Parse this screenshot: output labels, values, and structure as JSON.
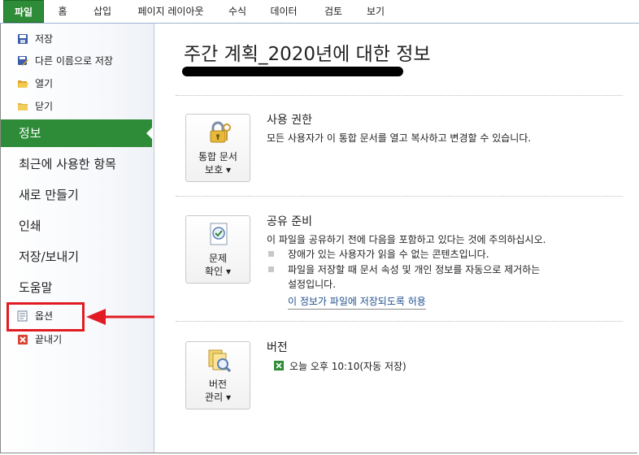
{
  "ribbon": {
    "tabs": [
      "파일",
      "홈",
      "삽입",
      "페이지 레이아웃",
      "수식",
      "데이터",
      "검토",
      "보기"
    ]
  },
  "sidebar": {
    "commands": [
      {
        "label": "저장",
        "icon": "save-icon"
      },
      {
        "label": "다른 이름으로 저장",
        "icon": "save-as-icon"
      },
      {
        "label": "열기",
        "icon": "open-folder-icon"
      },
      {
        "label": "닫기",
        "icon": "close-folder-icon"
      }
    ],
    "nav": [
      "정보",
      "최근에 사용한 항목",
      "새로 만들기",
      "인쇄",
      "저장/보내기",
      "도움말"
    ],
    "options_label": "옵션",
    "exit_label": "끝내기",
    "selected": "정보"
  },
  "main": {
    "title": "주간 계획_2020년에 대한 정보",
    "permissions": {
      "button_line1": "통합 문서",
      "button_line2": "보호",
      "heading": "사용 권한",
      "description": "모든 사용자가 이 통합 문서를 열고 복사하고 변경할 수 있습니다."
    },
    "prepare": {
      "button_line1": "문제",
      "button_line2": "확인",
      "heading": "공유 준비",
      "description": "이 파일을 공유하기 전에 다음을 포함하고 있다는 것에 주의하십시오.",
      "bullets": [
        "장애가 있는 사용자가 읽을 수 없는 콘텐츠입니다.",
        "파일을 저장할 때 문서 속성 및 개인 정보를 자동으로 제거하는",
        "설정입니다."
      ],
      "link": "이 정보가 파일에 저장되도록 허용"
    },
    "versions": {
      "button_line1": "버전",
      "button_line2": "관리",
      "heading": "버전",
      "item": "오늘 오후 10:10(자동 저장)"
    }
  },
  "colors": {
    "accent_green": "#2e8b37",
    "highlight_red": "#e21b22",
    "link_blue": "#1f4f8c"
  }
}
